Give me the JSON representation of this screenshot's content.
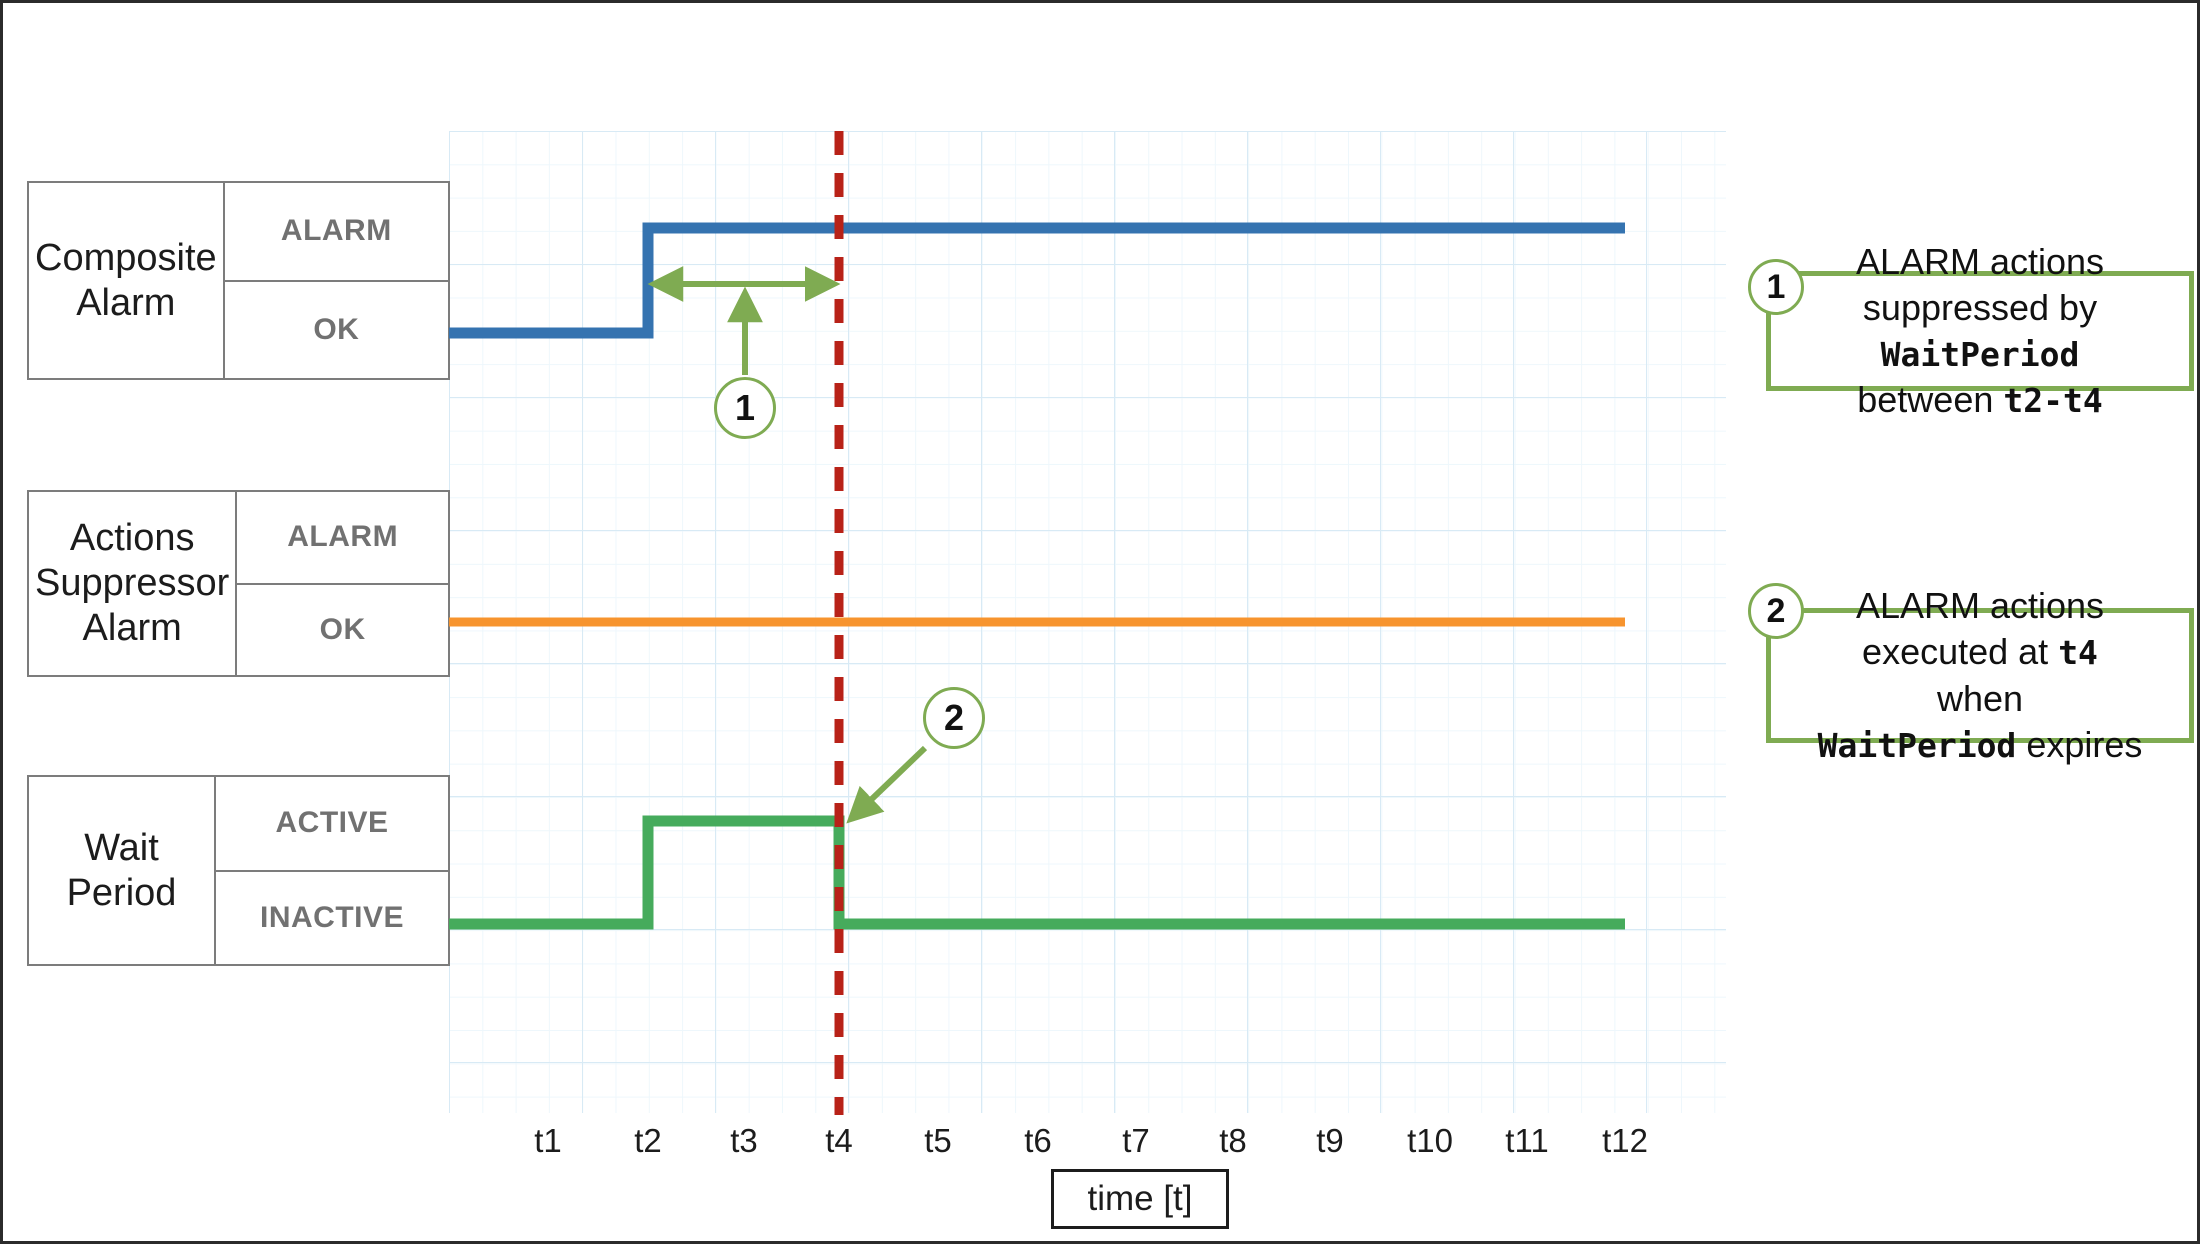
{
  "diagram": {
    "title": "CloudWatch composite alarm actions suppressor wait period timeline"
  },
  "rows": [
    {
      "name": "Composite\nAlarm",
      "name_line1": "Composite",
      "name_line2": "Alarm",
      "states": [
        "ALARM",
        "OK"
      ],
      "series_color": "#3573b0"
    },
    {
      "name_line1": "Actions",
      "name_line2": "Suppressor",
      "name_line3": "Alarm",
      "states": [
        "ALARM",
        "OK"
      ],
      "series_color": "#f7942e"
    },
    {
      "name_line1": "Wait",
      "name_line2": "Period",
      "states": [
        "ACTIVE",
        "INACTIVE"
      ],
      "series_color": "#46ab5c"
    }
  ],
  "axis": {
    "title": "time [t]",
    "ticks": [
      "t1",
      "t2",
      "t3",
      "t4",
      "t5",
      "t6",
      "t7",
      "t8",
      "t9",
      "t10",
      "t11",
      "t12"
    ]
  },
  "markers": {
    "plot_badge_1": "1",
    "plot_badge_2": "2",
    "right_badge_1": "1",
    "right_badge_2": "2",
    "reference_line_time": "t4"
  },
  "callouts": [
    {
      "number": "1",
      "line1": "ALARM actions",
      "line2": "suppressed by",
      "line3_mono": "WaitPeriod",
      "line4_pre": "between ",
      "line4_mono": "t2-t4"
    },
    {
      "number": "2",
      "line1": "ALARM actions",
      "line2_pre": "executed at ",
      "line2_mono": "t4",
      "line3": "when",
      "line4_mono": "WaitPeriod",
      "line4_post": " expires"
    }
  ],
  "colors": {
    "composite_alarm_line": "#3573b0",
    "actions_suppressor_line": "#f7942e",
    "wait_period_line": "#46ab5c",
    "reference_line": "#b82218",
    "annotation_green": "#7fab52",
    "grid_minor": "#eef7fc",
    "grid_major": "#d8eaf5",
    "box_border": "#7c7c7c",
    "state_text": "#717171"
  },
  "chart_data": {
    "type": "line",
    "title": "Composite alarm with actions suppressor wait period",
    "xlabel": "time [t]",
    "ylabel": "",
    "grid": true,
    "legend": "none",
    "x_ticks": [
      "t1",
      "t2",
      "t3",
      "t4",
      "t5",
      "t6",
      "t7",
      "t8",
      "t9",
      "t10",
      "t11",
      "t12"
    ],
    "reference_lines": [
      {
        "x": "t4",
        "style": "dashed",
        "color": "#b82218"
      }
    ],
    "series": [
      {
        "name": "Composite Alarm",
        "color": "#3573b0",
        "states": [
          "OK",
          "ALARM"
        ],
        "step_points": [
          {
            "x": "t0",
            "state": "OK"
          },
          {
            "x": "t2",
            "state": "ALARM"
          },
          {
            "x": "t12",
            "state": "ALARM"
          }
        ]
      },
      {
        "name": "Actions Suppressor Alarm",
        "color": "#f7942e",
        "states": [
          "OK",
          "ALARM"
        ],
        "step_points": [
          {
            "x": "t0",
            "state": "OK"
          },
          {
            "x": "t12",
            "state": "OK"
          }
        ]
      },
      {
        "name": "Wait Period",
        "color": "#46ab5c",
        "states": [
          "INACTIVE",
          "ACTIVE"
        ],
        "step_points": [
          {
            "x": "t0",
            "state": "INACTIVE"
          },
          {
            "x": "t2",
            "state": "ACTIVE"
          },
          {
            "x": "t4",
            "state": "INACTIVE"
          },
          {
            "x": "t12",
            "state": "INACTIVE"
          }
        ]
      }
    ],
    "annotations": [
      {
        "id": "1",
        "type": "span-arrow",
        "from": "t2",
        "to": "t4",
        "text": "ALARM actions suppressed by WaitPeriod between t2-t4"
      },
      {
        "id": "2",
        "type": "point-arrow",
        "at": "t4",
        "text": "ALARM actions executed at t4 when WaitPeriod expires"
      }
    ]
  }
}
